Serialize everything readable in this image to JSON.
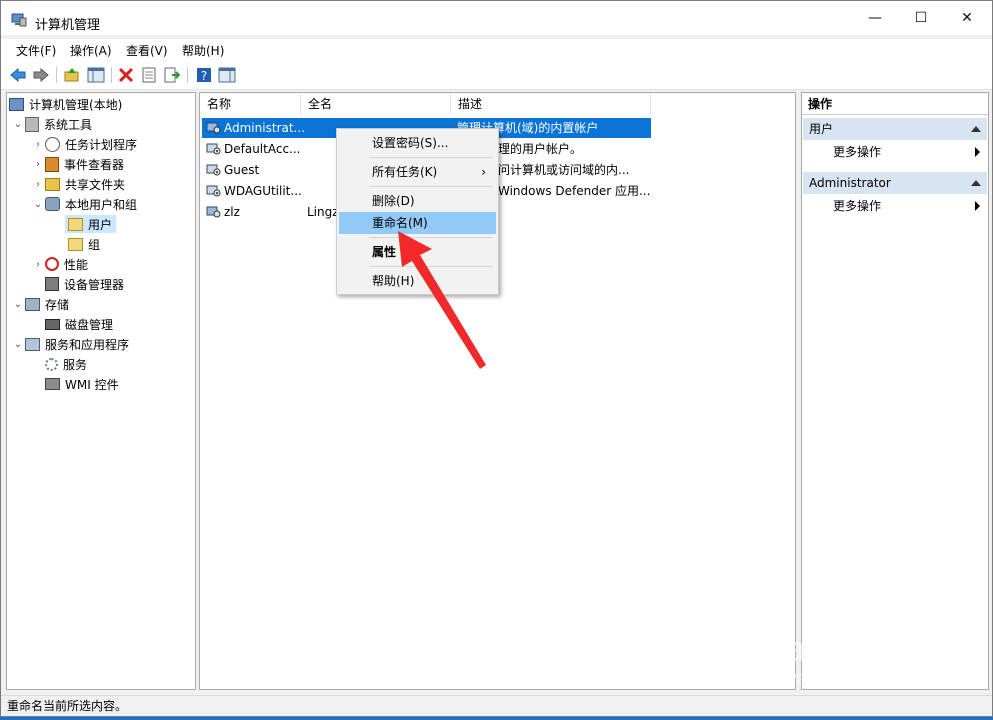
{
  "window": {
    "title": "计算机管理",
    "min": "—",
    "max": "☐",
    "close": "✕"
  },
  "menu": [
    "文件(F)",
    "操作(A)",
    "查看(V)",
    "帮助(H)"
  ],
  "tree": {
    "root": "计算机管理(本地)",
    "system_tools": "系统工具",
    "task_scheduler": "任务计划程序",
    "event_viewer": "事件查看器",
    "shared_folders": "共享文件夹",
    "local_users_groups": "本地用户和组",
    "users": "用户",
    "groups": "组",
    "performance": "性能",
    "device_manager": "设备管理器",
    "storage": "存储",
    "disk_management": "磁盘管理",
    "services_apps": "服务和应用程序",
    "services": "服务",
    "wmi": "WMI 控件"
  },
  "list": {
    "columns": [
      "名称",
      "全名",
      "描述"
    ],
    "rows": [
      {
        "name": "Administrat...",
        "full": "",
        "desc": "管理计算机(域)的内置帐户"
      },
      {
        "name": "DefaultAcc...",
        "full": "",
        "desc": "理的用户帐户。"
      },
      {
        "name": "Guest",
        "full": "",
        "desc": "问计算机或访问域的内..."
      },
      {
        "name": "WDAGUtilit...",
        "full": "",
        "desc": "Windows Defender 应用..."
      },
      {
        "name": "zlz",
        "full": "Lingz",
        "desc": ""
      }
    ]
  },
  "context_menu": {
    "set_password": "设置密码(S)...",
    "all_tasks": "所有任务(K)",
    "all_tasks_arrow": "›",
    "delete": "删除(D)",
    "rename": "重命名(M)",
    "properties": "属性",
    "help": "帮助(H)"
  },
  "actions": {
    "header": "操作",
    "section1": "用户",
    "section1_more": "更多操作",
    "section2": "Administrator",
    "section2_more": "更多操作"
  },
  "status": "重命名当前所选内容。",
  "watermark": {
    "logo": "Bai du 经验",
    "url": "jingyan.baidu.com"
  },
  "colors": {
    "selection": "#0a73d6",
    "menu_highlight": "#91c9f7",
    "arrow": "#f02a2a"
  }
}
